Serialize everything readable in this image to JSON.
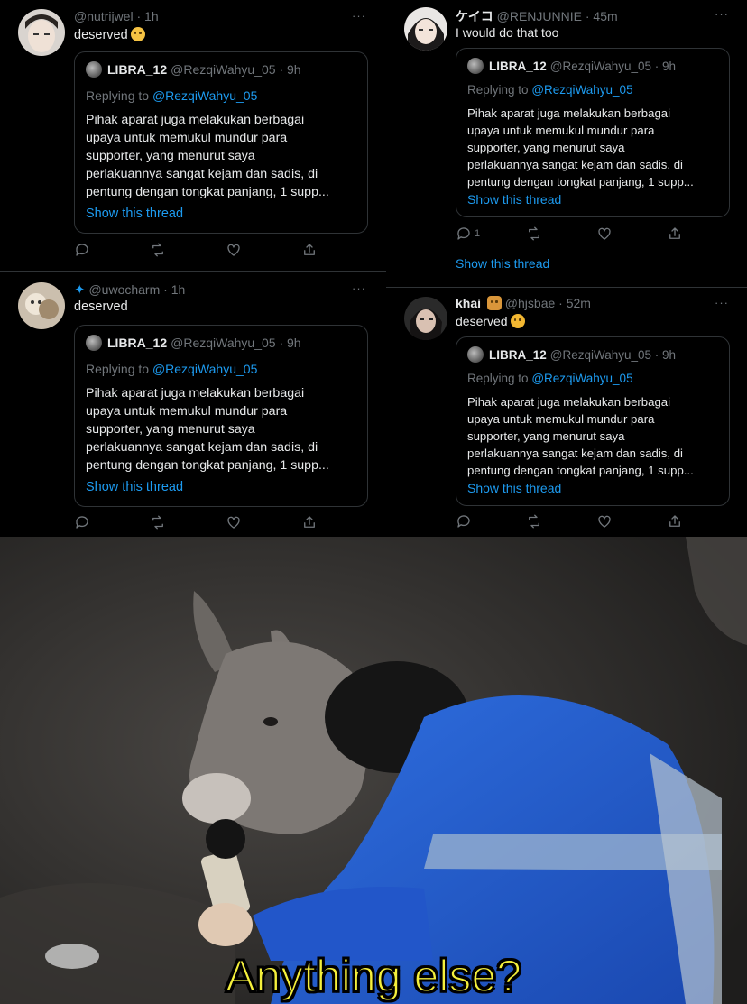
{
  "tweets": [
    {
      "handle": "@nutrijwel",
      "time": "1h",
      "text": "deserved",
      "emoji": "smiling-face-emoji",
      "more": "···"
    },
    {
      "handle": "@uwocharm",
      "time": "1h",
      "text": "deserved",
      "prefix_icon": "blue-butterfly-emoji",
      "more": "···"
    },
    {
      "display_name": "ケイコ",
      "handle": "@RENJUNNIE",
      "time": "45m",
      "text": "I would do that too",
      "more": "···",
      "reply_count": "1",
      "show_thread": "Show this thread"
    },
    {
      "display_name": "khai",
      "display_emoji": "teddy-bear-emoji",
      "handle": "@hjsbae",
      "time": "52m",
      "text": "deserved",
      "emoji": "cat-face-emoji",
      "more": "···"
    }
  ],
  "quoted": {
    "name": "LIBRA_12",
    "handle": "@RezqiWahyu_05",
    "time": "9h",
    "replying_prefix": "Replying to",
    "replying_handle": "@RezqiWahyu_05",
    "body_lines": [
      "Pihak aparat juga melakukan berbagai",
      "upaya untuk memukul mundur para",
      "supporter, yang menurut saya",
      "perlakuannya sangat kejam dan sadis, di",
      "pentung dengan tongkat panjang, 1 supp..."
    ],
    "show_thread": "Show this thread"
  },
  "meme": {
    "caption": "Anything else?"
  },
  "colors": {
    "background": "#000000",
    "text": "#e7e9ea",
    "muted": "#71767b",
    "link": "#1d9bf0",
    "border": "#2f3336",
    "caption": "#f4ef3c"
  }
}
